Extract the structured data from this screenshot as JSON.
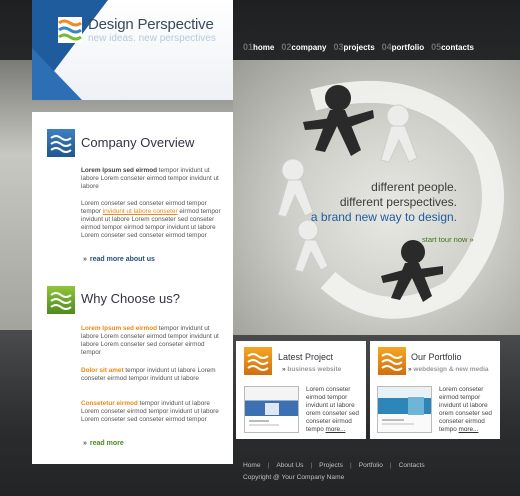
{
  "logo": {
    "title": "Design Perspective",
    "tagline": "new ideas. new perspectives"
  },
  "nav": [
    {
      "num": "01",
      "label": "home"
    },
    {
      "num": "02",
      "label": "company"
    },
    {
      "num": "03",
      "label": "projects"
    },
    {
      "num": "04",
      "label": "portfolio"
    },
    {
      "num": "05",
      "label": "contacts"
    }
  ],
  "overview": {
    "title": "Company Overview",
    "p1_bold": "Lorem Ipsum sed eirmod",
    "p1_rest": " tempor invidunt ut labore Lorem conseter eirmod tempor invidunt ut labore",
    "p2_a": "Lorem conseter sed conseter eirmod tempor tempor ",
    "p2_link": "invidunt ut labore conseter",
    "p2_b": " eirmod tempor invidunt ut labore Lorem conseter sed conseter eirmod tempor eirmod tempor invidunt ut labore Lorem conseter sed conseter eirmod tempor",
    "more": "read more about us"
  },
  "why": {
    "title": "Why Choose us?",
    "i1_head": "Lorem Ipsum sed eirmod",
    "i1_rest": " tempor invidunt ut labore Lorem conseter eirmod tempor invidunt ut labore Lorem conseter sed conseter eirmod tempor",
    "i2_head": "Dolor sit amet",
    "i2_rest": " tempor invidunt ut labore Lorem conseter eirmod tempor invidunt ut labore",
    "i3_head": "Consetetur eirmod",
    "i3_rest": " tempor invidunt ut labore Lorem conseter eirmod tempor invidunt ut labore Lorem conseter sed conseter eirmod tempor",
    "more": "read more"
  },
  "hero": {
    "line1": "different people.",
    "line2": "different perspectives.",
    "line3": "a brand new way to design.",
    "cta": "start tour now"
  },
  "latest_project": {
    "title": "Latest Project",
    "subtitle": "business website",
    "text": "Lorem conseter eirmod tempor invidunt ut labore orem conseter sed conseter eirmod tempo ",
    "more": "more..."
  },
  "portfolio": {
    "title": "Our Portfolio",
    "subtitle": "webdesign & new media",
    "text": "Lorem conseter eirmod tempor invidunt ut labore orem conseter sed conseter eirmod tempo ",
    "more": "more..."
  },
  "footer": {
    "links": [
      "Home",
      "About Us",
      "Projects",
      "Portfolio",
      "Contacts"
    ],
    "separator": "|",
    "copyright": "Copyright @ Your Company Name"
  },
  "colors": {
    "accent_blue": "#1f5c9e",
    "accent_orange": "#e88a17",
    "accent_green": "#4e8a1f"
  }
}
